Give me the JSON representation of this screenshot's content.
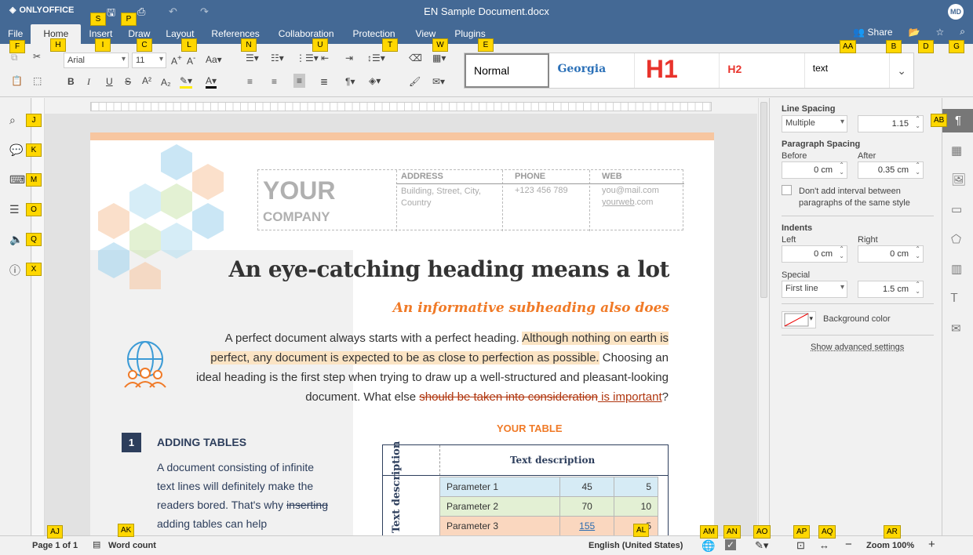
{
  "window": {
    "logo": "ONLYOFFICE",
    "title": "EN Sample Document.docx",
    "avatar": "MD"
  },
  "tabs": [
    "File",
    "Home",
    "Insert",
    "Draw",
    "Layout",
    "References",
    "Collaboration",
    "Protection",
    "View",
    "Plugins"
  ],
  "actions": {
    "share": "Share"
  },
  "toolbar": {
    "font_name": "Arial",
    "font_size": "11"
  },
  "styles": [
    "Normal",
    "Georgia",
    "H1",
    "H2",
    "text"
  ],
  "document": {
    "company_big": "YOUR",
    "company_small": "COMPANY",
    "address_label": "ADDRESS",
    "address_value": "Building, Street, City, Country",
    "phone_label": "PHONE",
    "phone_value": "+123 456 789",
    "web_label": "WEB",
    "web_value1": "you@mail.com",
    "web_value2_link": "yourweb",
    "web_value2_rest": ".com",
    "heading": "An eye-catching heading means a lot",
    "subheading": "An informative subheading also does",
    "para_a": "A perfect document always starts with a perfect heading.",
    "para_highlight": "Although nothing on earth is perfect, any document is expected to be as close to perfection as possible.",
    "para_b": "Choosing an ideal heading is the first step when trying to draw up a well-structured and pleasant-looking document. What else",
    "para_strike": "should be taken into consideration",
    "para_insert": " is important",
    "para_end": "?",
    "section_number": "1",
    "section_title": "ADDING TABLES",
    "section_strike": "inserting",
    "section_text_a": "A document consisting of infinite text lines will definitely make the readers bored. That's why",
    "section_text_b": "adding tables can help",
    "table_caption": "YOUR TABLE",
    "table_header": "Text description",
    "table_side": "Text description",
    "rows": [
      {
        "name": "Parameter 1",
        "v1": "45",
        "v2": "5"
      },
      {
        "name": "Parameter 2",
        "v1": "70",
        "v2": "10"
      },
      {
        "name": "Parameter 3",
        "v1": "155",
        "v2": "5"
      }
    ]
  },
  "panel": {
    "line_spacing": "Line Spacing",
    "line_spacing_mode": "Multiple",
    "line_spacing_value": "1.15",
    "paragraph_spacing": "Paragraph Spacing",
    "before": "Before",
    "after": "After",
    "before_value": "0 cm",
    "after_value": "0.35 cm",
    "dont_add": "Don't add interval between paragraphs of the same style",
    "indents": "Indents",
    "left": "Left",
    "right": "Right",
    "left_value": "0 cm",
    "right_value": "0 cm",
    "special": "Special",
    "special_mode": "First line",
    "special_value": "1.5 cm",
    "background_color": "Background color",
    "advanced": "Show advanced settings"
  },
  "status": {
    "page": "Page 1 of 1",
    "word_count": "Word count",
    "language": "English (United States)",
    "zoom": "Zoom 100%"
  },
  "hints": [
    "F",
    "H",
    "S",
    "P",
    "I",
    "C",
    "L",
    "N",
    "U",
    "T",
    "W",
    "E",
    "AA",
    "B",
    "D",
    "G",
    "J",
    "K",
    "M",
    "O",
    "Q",
    "X",
    "AB",
    "AJ",
    "AK",
    "AL",
    "AM",
    "AN",
    "AO",
    "AP",
    "AQ",
    "AR"
  ]
}
